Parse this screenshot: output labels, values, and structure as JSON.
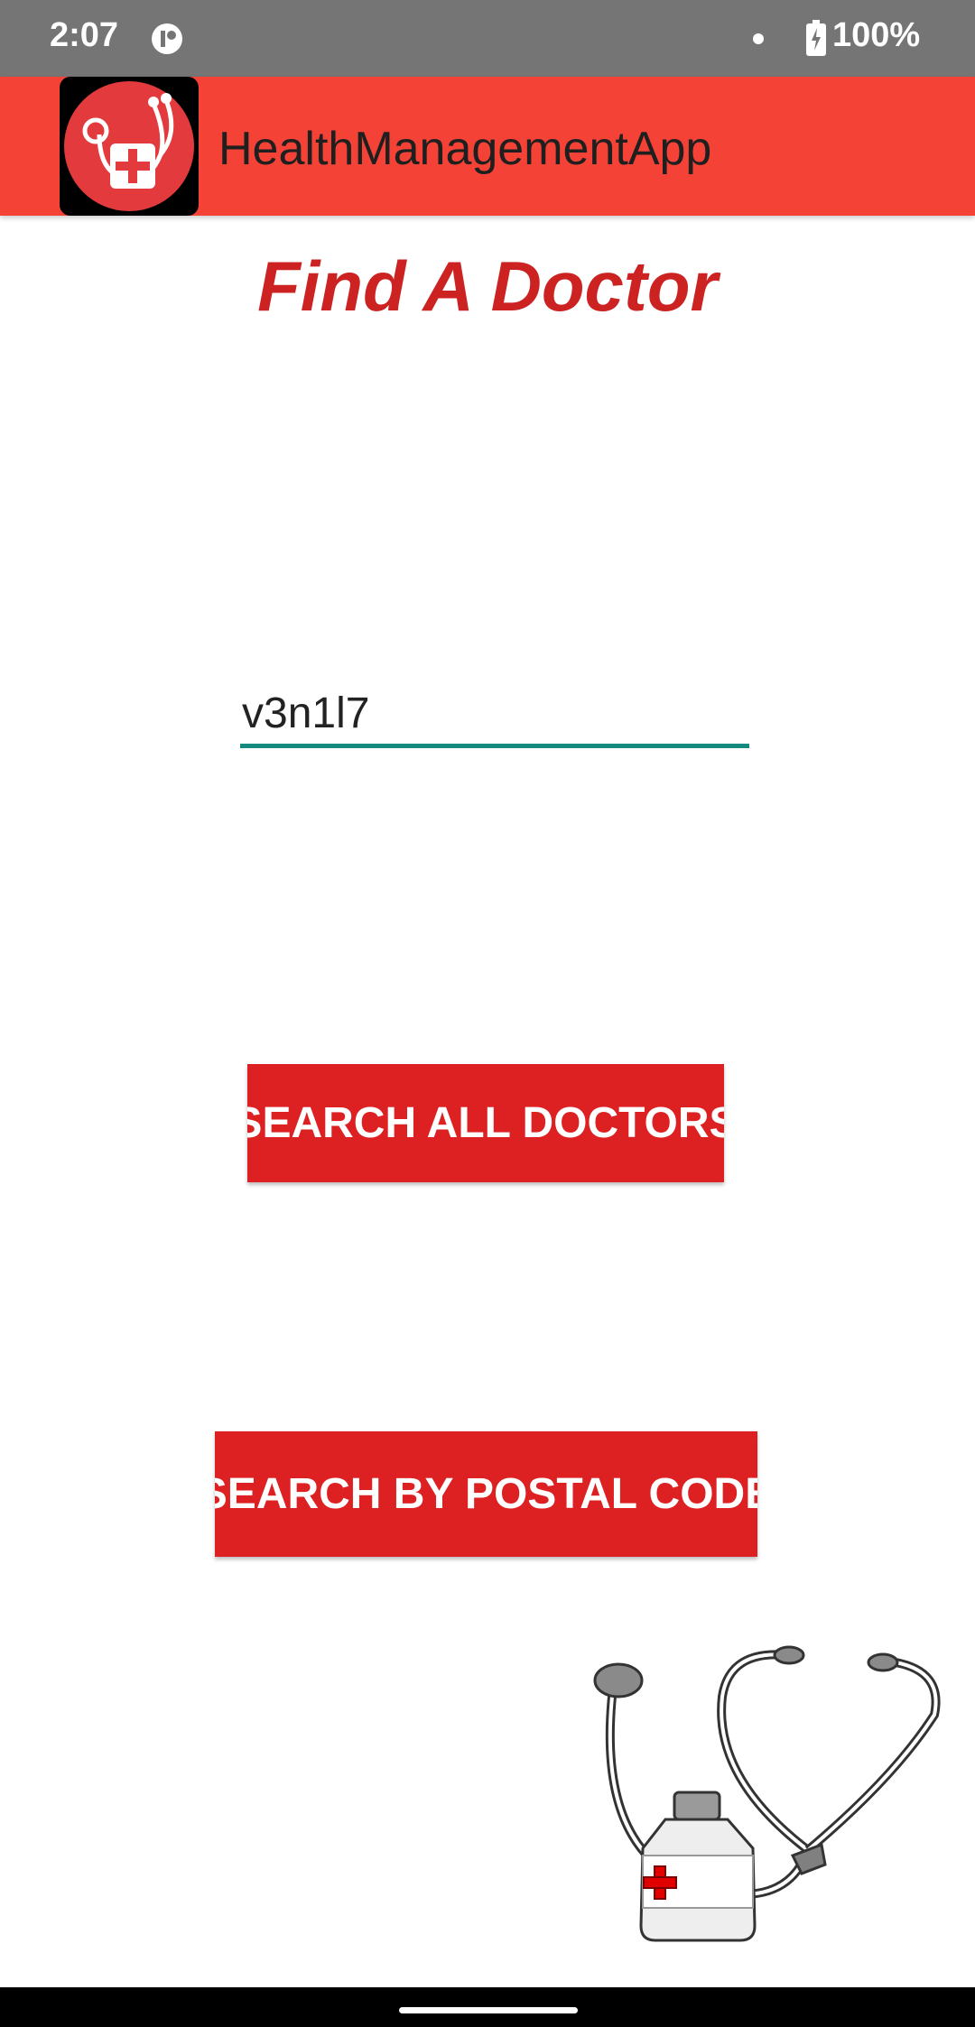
{
  "status_bar": {
    "time": "2:07",
    "battery": "100%",
    "icons": [
      "notification-icon",
      "dot-icon",
      "battery-charging-icon"
    ]
  },
  "app_bar": {
    "title": "HealthManagementApp",
    "logo_icon": "stethoscope-medical-cross-logo",
    "background_color": "#f44336"
  },
  "main": {
    "title": "Find A Doctor",
    "title_color": "#cc2222",
    "postal_input": {
      "value": "v3n1l7",
      "underline_color": "#138a7d"
    },
    "buttons": {
      "search_all": "SEARCH ALL DOCTORS",
      "search_postal": "SEARCH BY POSTAL CODE",
      "color": "#dd2021"
    },
    "illustration_icon": "stethoscope-medicine-bottle-illustration"
  },
  "navigation_bar": {
    "home_handle": "home-handle"
  }
}
